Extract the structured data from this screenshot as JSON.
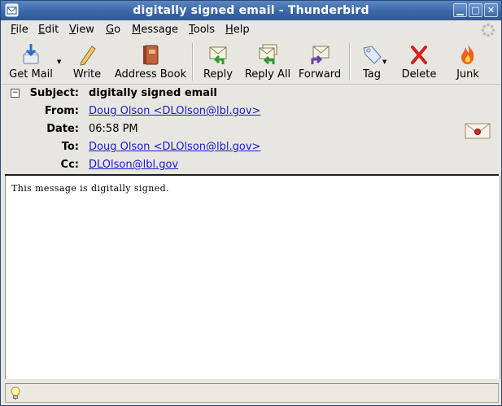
{
  "window": {
    "title": "digitally signed email - Thunderbird"
  },
  "menu": [
    {
      "first": "F",
      "rest": "ile"
    },
    {
      "first": "E",
      "rest": "dit"
    },
    {
      "first": "V",
      "rest": "iew"
    },
    {
      "first": "G",
      "rest": "o"
    },
    {
      "first": "M",
      "rest": "essage"
    },
    {
      "first": "T",
      "rest": "ools"
    },
    {
      "first": "H",
      "rest": "elp"
    }
  ],
  "toolbar": {
    "get_mail": "Get Mail",
    "write": "Write",
    "address_book": "Address Book",
    "reply": "Reply",
    "reply_all": "Reply All",
    "forward": "Forward",
    "tag": "Tag",
    "delete": "Delete",
    "junk": "Junk"
  },
  "header": {
    "subject_label": "Subject:",
    "subject": "digitally signed email",
    "from_label": "From:",
    "from": "Doug Olson <DLOlson@lbl.gov>",
    "date_label": "Date:",
    "date": "06:58 PM",
    "to_label": "To:",
    "to": "Doug Olson <DLOlson@lbl.gov>",
    "cc_label": "Cc:",
    "cc": "DLOlson@lbl.gov"
  },
  "message": {
    "body": "This message is digitally signed."
  },
  "icons": {
    "app": "thunderbird-icon",
    "signed": "signed-envelope-icon",
    "status": "lightbulb-icon"
  }
}
